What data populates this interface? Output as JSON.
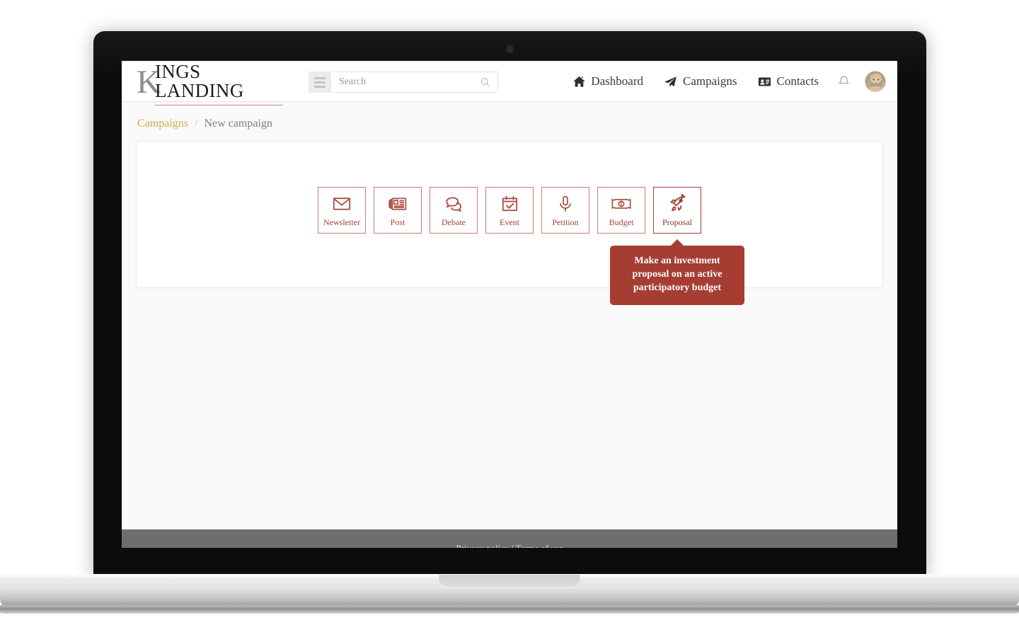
{
  "brand": {
    "logo_initial": "K",
    "logo_rest": "INGS LANDING",
    "accent_red": "#a63d33",
    "accent_gold": "#d3a84b"
  },
  "topbar": {
    "menu_icon": "hamburger-icon",
    "search": {
      "placeholder": "Search",
      "value": "",
      "icon": "search-icon"
    },
    "nav": [
      {
        "label": "Dashboard",
        "icon": "home-icon"
      },
      {
        "label": "Campaigns",
        "icon": "paper-plane-icon"
      },
      {
        "label": "Contacts",
        "icon": "contact-card-icon"
      }
    ],
    "notifications_icon": "bell-icon",
    "avatar": "user-avatar"
  },
  "breadcrumb": {
    "parent": "Campaigns",
    "separator": "/",
    "current": "New campaign"
  },
  "campaign_types": [
    {
      "label": "Newsletter",
      "icon": "envelope-icon",
      "active": false
    },
    {
      "label": "Post",
      "icon": "newspaper-icon",
      "active": false
    },
    {
      "label": "Debate",
      "icon": "speech-bubbles-icon",
      "active": false
    },
    {
      "label": "Event",
      "icon": "calendar-check-icon",
      "active": false
    },
    {
      "label": "Petition",
      "icon": "microphone-icon",
      "active": false
    },
    {
      "label": "Budget",
      "icon": "banknote-icon",
      "active": false
    },
    {
      "label": "Proposal",
      "icon": "rocket-icon",
      "active": true
    }
  ],
  "tooltip": {
    "text": "Make an investment proposal on an active participatory budget",
    "for": "Proposal"
  },
  "footer": {
    "text": "Privacy policy | Terms of use"
  }
}
